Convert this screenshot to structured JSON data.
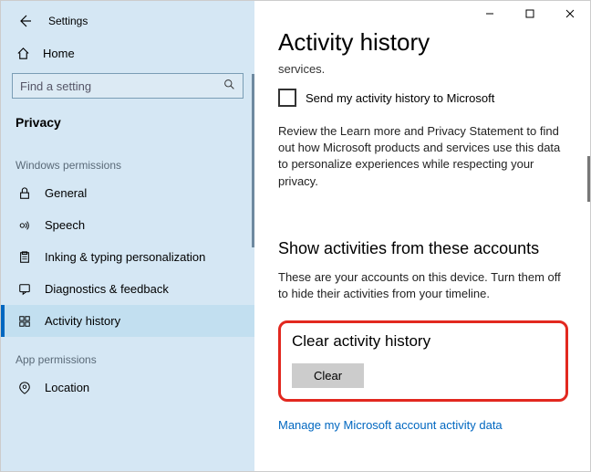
{
  "window": {
    "title": "Settings"
  },
  "sidebar": {
    "home_label": "Home",
    "search_placeholder": "Find a setting",
    "current_page": "Privacy",
    "section1_label": "Windows permissions",
    "section2_label": "App permissions",
    "items": [
      {
        "label": "General"
      },
      {
        "label": "Speech"
      },
      {
        "label": "Inking & typing personalization"
      },
      {
        "label": "Diagnostics & feedback"
      },
      {
        "label": "Activity history"
      }
    ],
    "items2": [
      {
        "label": "Location"
      }
    ]
  },
  "main": {
    "title": "Activity history",
    "cutoff_text": "services.",
    "checkbox_label": "Send my activity history to Microsoft",
    "review_text": "Review the Learn more and Privacy Statement to find out how Microsoft products and services use this data to personalize experiences while respecting your privacy.",
    "show_heading": "Show activities from these accounts",
    "show_text": "These are your accounts on this device. Turn them off to hide their activities from your timeline.",
    "clear_heading": "Clear activity history",
    "clear_button": "Clear",
    "manage_link": "Manage my Microsoft account activity data"
  }
}
